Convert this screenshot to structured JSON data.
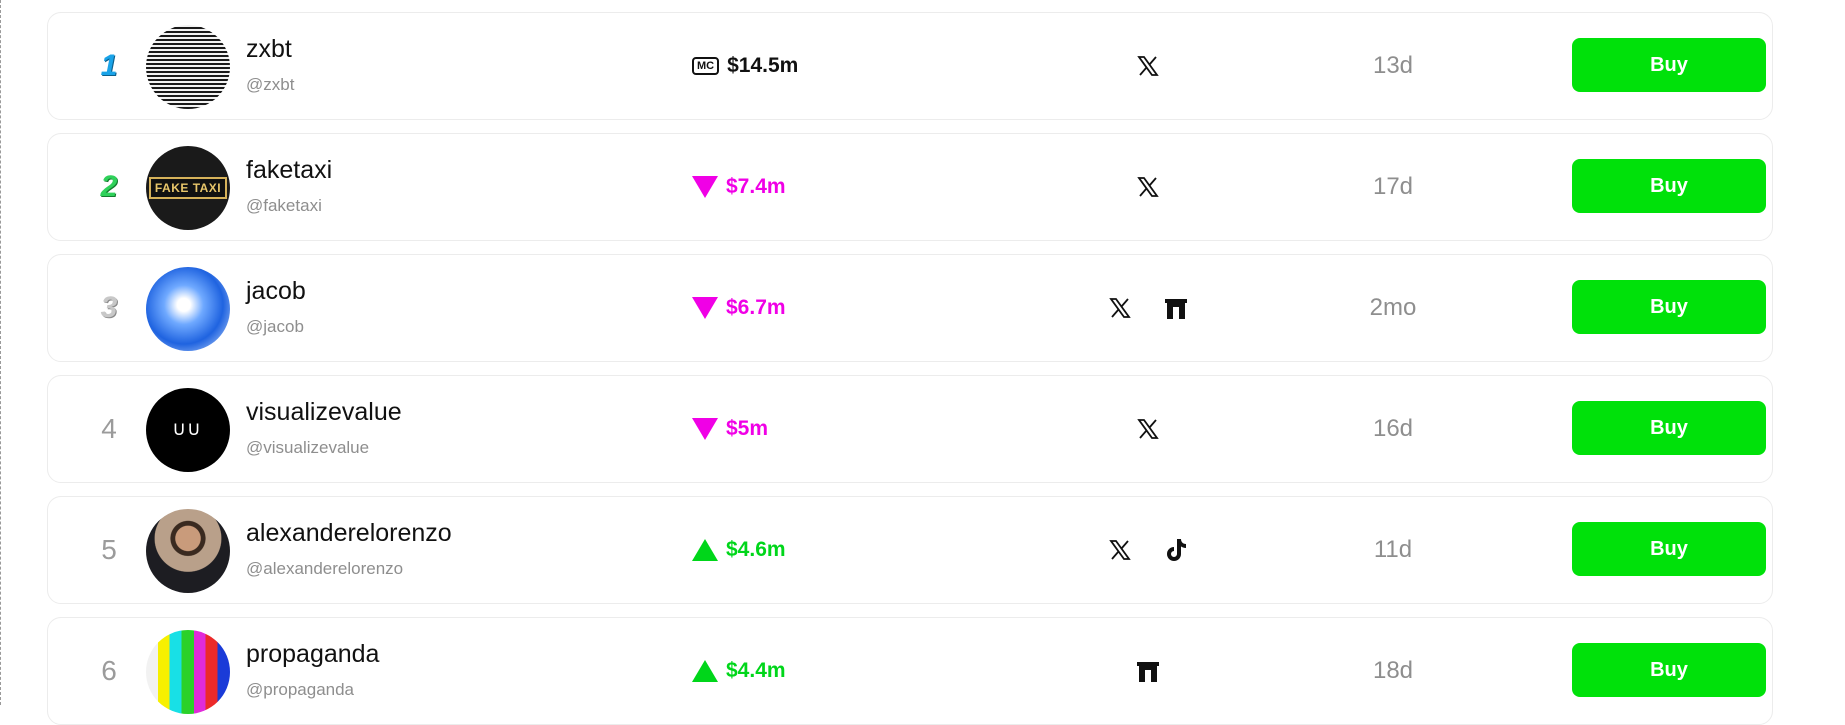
{
  "rows": [
    {
      "rank": "1",
      "name": "zxbt",
      "handle": "@zxbt",
      "market_cap": "$14.5m",
      "trend": "plain",
      "socials": [
        "x-icon"
      ],
      "age": "13d",
      "buy_label": "Buy"
    },
    {
      "rank": "2",
      "name": "faketaxi",
      "handle": "@faketaxi",
      "market_cap": "$7.4m",
      "trend": "down",
      "socials": [
        "x-icon"
      ],
      "age": "17d",
      "buy_label": "Buy",
      "avatar_text": "FAKE TAXI"
    },
    {
      "rank": "3",
      "name": "jacob",
      "handle": "@jacob",
      "market_cap": "$6.7m",
      "trend": "down",
      "socials": [
        "x-icon",
        "gate-icon"
      ],
      "age": "2mo",
      "buy_label": "Buy"
    },
    {
      "rank": "4",
      "name": "visualizevalue",
      "handle": "@visualizevalue",
      "market_cap": "$5m",
      "trend": "down",
      "socials": [
        "x-icon"
      ],
      "age": "16d",
      "buy_label": "Buy",
      "avatar_text": "ᑌᑌ"
    },
    {
      "rank": "5",
      "name": "alexanderelorenzo",
      "handle": "@alexanderelorenzo",
      "market_cap": "$4.6m",
      "trend": "up",
      "socials": [
        "x-icon",
        "tiktok-icon"
      ],
      "age": "11d",
      "buy_label": "Buy"
    },
    {
      "rank": "6",
      "name": "propaganda",
      "handle": "@propaganda",
      "market_cap": "$4.4m",
      "trend": "up",
      "socials": [
        "gate-icon"
      ],
      "age": "18d",
      "buy_label": "Buy"
    }
  ],
  "mc_badge": "MC",
  "colors": {
    "buy": "#00e10a",
    "down": "#f000e6",
    "up": "#00d61a",
    "medal_1": "#1aa3e8",
    "medal_2": "#2fd15a",
    "medal_3": "#c8c8c8"
  }
}
